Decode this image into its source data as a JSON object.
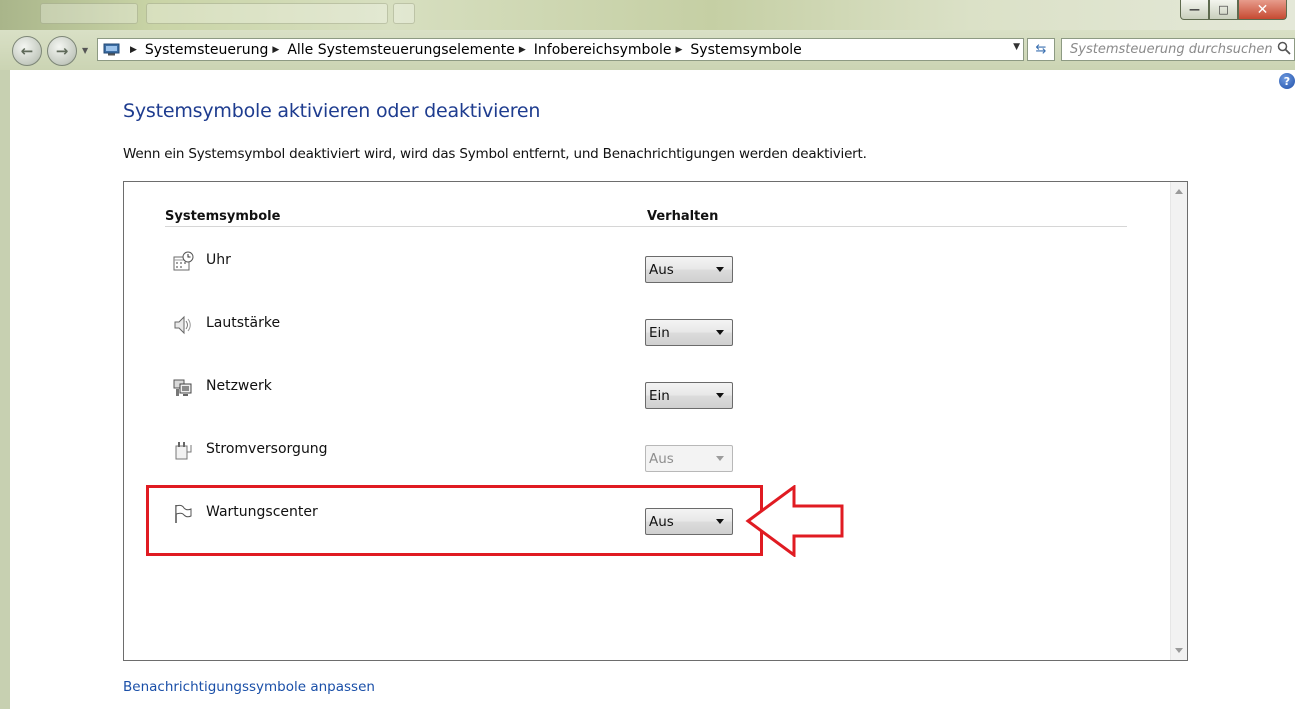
{
  "window": {
    "title_controls": {
      "minimize": "—",
      "maximize": "□",
      "close": "✕"
    },
    "search_placeholder": "Systemsteuerung durchsuchen",
    "breadcrumbs": [
      "Systemsteuerung",
      "Alle Systemsteuerungselemente",
      "Infobereichsymbole",
      "Systemsymbole"
    ],
    "icons": [
      "back-icon",
      "forward-icon",
      "computer-icon",
      "refresh-icon",
      "search-icon",
      "help-icon"
    ]
  },
  "page": {
    "heading": "Systemsymbole aktivieren oder deaktivieren",
    "description": "Wenn ein Systemsymbol deaktiviert wird, wird das Symbol entfernt, und Benachrichtigungen werden deaktiviert.",
    "help_label": "?",
    "footer_link": "Benachrichtigungssymbole anpassen"
  },
  "table": {
    "col_symbols": "Systemsymbole",
    "col_behavior": "Verhalten",
    "rows": [
      {
        "label": "Uhr",
        "value": "Aus",
        "disabled": false,
        "icon": "clock-icon"
      },
      {
        "label": "Lautstärke",
        "value": "Ein",
        "disabled": false,
        "icon": "speaker-icon"
      },
      {
        "label": "Netzwerk",
        "value": "Ein",
        "disabled": false,
        "icon": "network-icon"
      },
      {
        "label": "Stromversorgung",
        "value": "Aus",
        "disabled": true,
        "icon": "power-icon"
      },
      {
        "label": "Wartungscenter",
        "value": "Aus",
        "disabled": false,
        "icon": "flag-icon"
      }
    ]
  },
  "annotation": {
    "highlighted_row": "Wartungscenter",
    "color": "#e01b22"
  }
}
